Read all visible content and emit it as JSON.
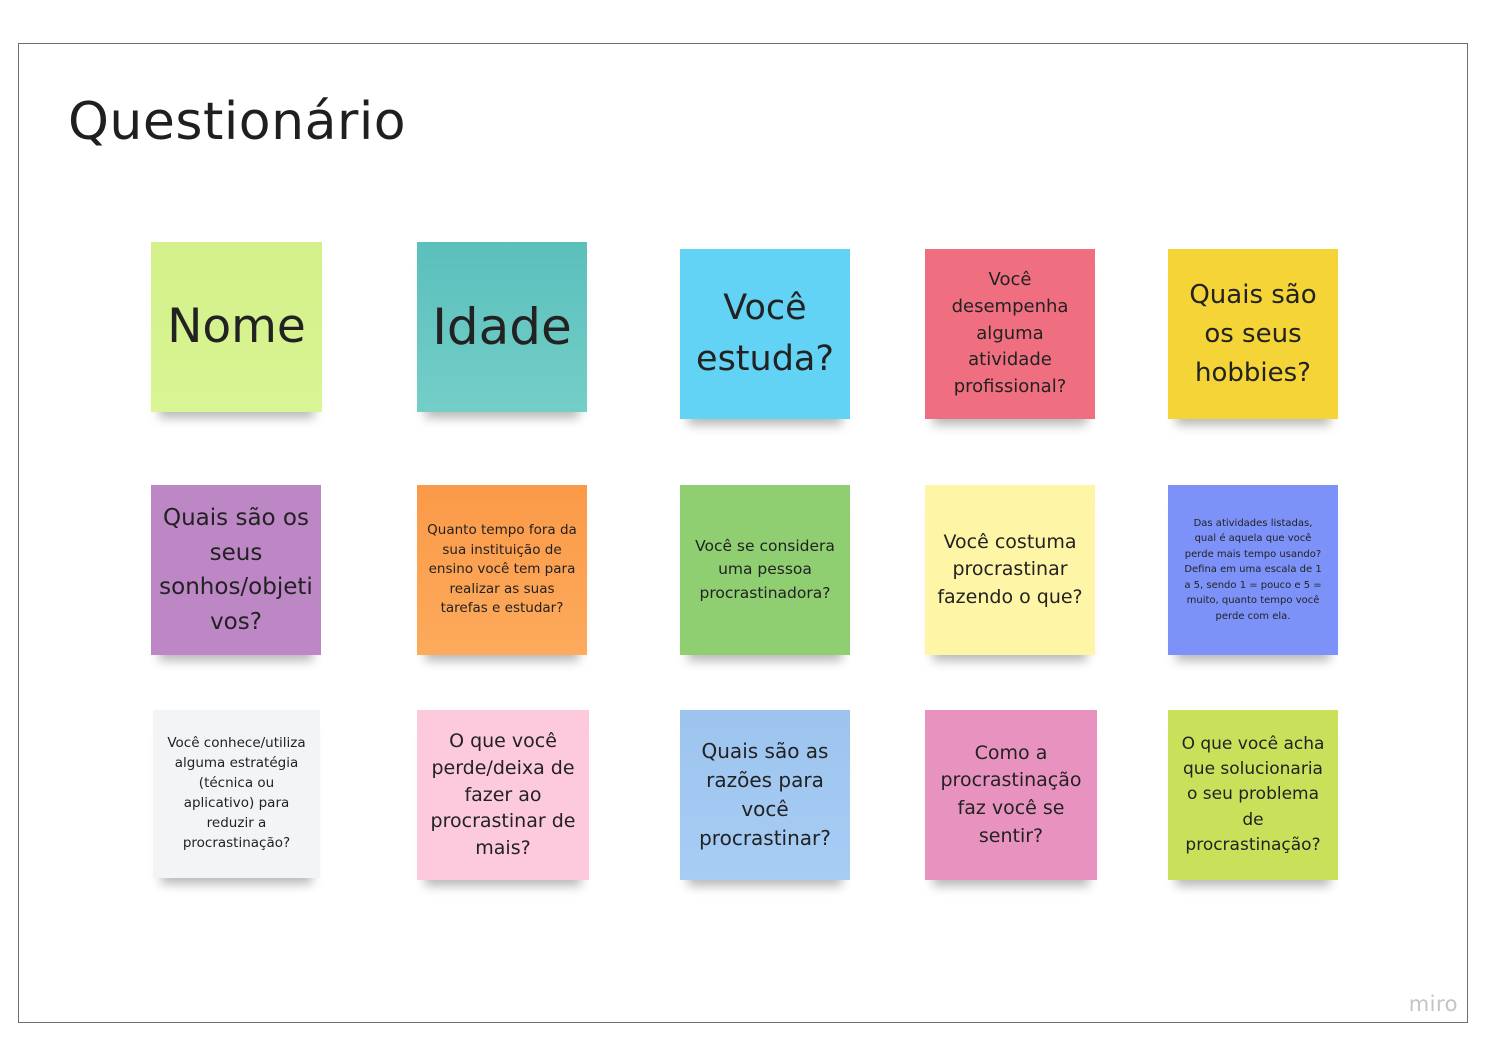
{
  "board": {
    "title": "Questionário",
    "logo": "miro"
  },
  "notes": [
    {
      "text": "Nome",
      "color": "#d7f38e"
    },
    {
      "text": "Idade",
      "color": "#67c6c1"
    },
    {
      "text": "Você estuda?",
      "color": "#62d3f5"
    },
    {
      "text": "Você desempenha alguma atividade profissional?",
      "color": "#ef6f80"
    },
    {
      "text": "Quais são os seus hobbies?",
      "color": "#f4d437"
    },
    {
      "text": "Quais são os seus sonhos/objetivos?",
      "color": "#bd87c6"
    },
    {
      "text": "Quanto tempo fora da sua instituição de ensino você tem para realizar as suas tarefas e estudar?",
      "color": "#fba152"
    },
    {
      "text": "Você se considera uma pessoa procrastinadora?",
      "color": "#8fcf72"
    },
    {
      "text": "Você costuma procrastinar fazendo o que?",
      "color": "#fff5a6"
    },
    {
      "text": "Das atividades listadas, qual é aquela que você perde mais tempo usando? Defina em uma escala de 1 a 5, sendo 1 = pouco e 5 = muito, quanto tempo você perde com ela.",
      "color": "#7d92f8"
    },
    {
      "text": "Você conhece/utiliza alguma estratégia (técnica ou aplicativo) para reduzir a procrastinação?",
      "color": "#f3f4f6"
    },
    {
      "text": "O que você perde/deixa de fazer ao procrastinar de mais?",
      "color": "#fdc9dd"
    },
    {
      "text": "Quais são as razões para você procrastinar?",
      "color": "#a2c8f1"
    },
    {
      "text": "Como a procrastinação faz você se sentir?",
      "color": "#e893bf"
    },
    {
      "text": "O que você acha que solucionaria o seu problema de procrastinação?",
      "color": "#c9e05a"
    }
  ]
}
